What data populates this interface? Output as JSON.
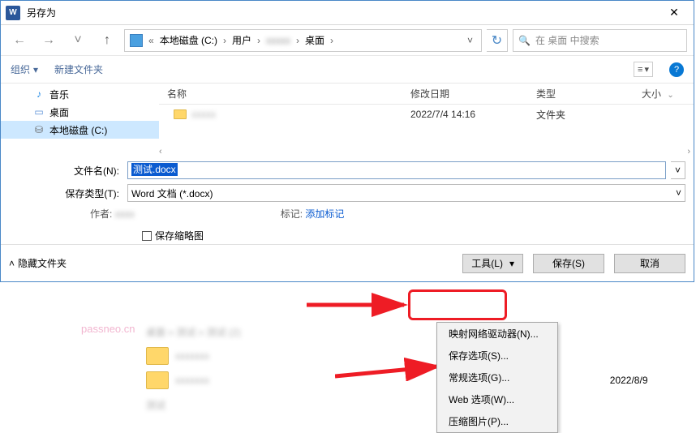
{
  "window": {
    "title": "另存为"
  },
  "breadcrumb": {
    "root_icon": "«",
    "items": [
      "本地磁盘 (C:)",
      "用户",
      "",
      "桌面"
    ]
  },
  "search": {
    "placeholder": "在 桌面 中搜索"
  },
  "toolbar": {
    "organize": "组织",
    "newfolder": "新建文件夹"
  },
  "sidebar": {
    "items": [
      {
        "label": "音乐",
        "icon": "music"
      },
      {
        "label": "桌面",
        "icon": "desktop"
      },
      {
        "label": "本地磁盘 (C:)",
        "icon": "disk",
        "selected": true
      }
    ]
  },
  "columns": {
    "name": "名称",
    "date": "修改日期",
    "type": "类型",
    "size": "大小"
  },
  "files": [
    {
      "name": "",
      "date": "2022/7/4 14:16",
      "type": "文件夹"
    }
  ],
  "fields": {
    "filename_label": "文件名(N):",
    "filename_value": "测试.docx",
    "filetype_label": "保存类型(T):",
    "filetype_value": "Word 文档 (*.docx)",
    "author_label": "作者:",
    "author_value": "",
    "tag_label": "标记:",
    "tag_value": "添加标记",
    "thumb_label": "保存缩略图"
  },
  "bottom": {
    "hide": "隐藏文件夹",
    "tools": "工具(L)",
    "save": "保存(S)",
    "cancel": "取消"
  },
  "tools_menu": {
    "items": [
      "映射网络驱动器(N)...",
      "保存选项(S)...",
      "常规选项(G)...",
      "Web 选项(W)...",
      "压缩图片(P)..."
    ]
  },
  "behind": {
    "crumb": "桌面 » 测试 » 测试 (2)",
    "rows": [
      {
        "name": "",
        "date": ""
      },
      {
        "name": "",
        "date": "2022/8/9"
      }
    ],
    "footer_name": "测试"
  },
  "watermark": "passneo.cn"
}
